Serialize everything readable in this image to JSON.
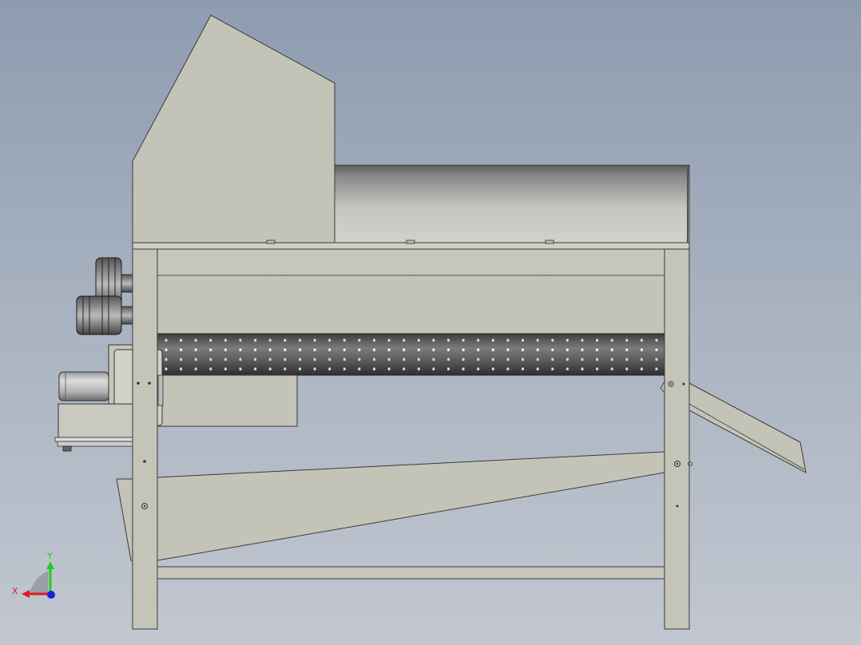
{
  "triad": {
    "x_label": "X",
    "y_label": "Y",
    "colors": {
      "x": "#e21a1a",
      "y": "#1ccf1c",
      "z": "#1f1fd8"
    }
  },
  "colors": {
    "sheet_metal": "#c3c3b8",
    "frame": "#c4c4b9",
    "outline": "#3a3a3a",
    "drum_dark": "#4a4a4a",
    "drum_light": "#8a8a8a",
    "cylinder_dark": "#6a6a6a",
    "cylinder_light": "#c8c8c8"
  },
  "drum": {
    "perforation_columns": 34,
    "perforation_rows": 4
  }
}
